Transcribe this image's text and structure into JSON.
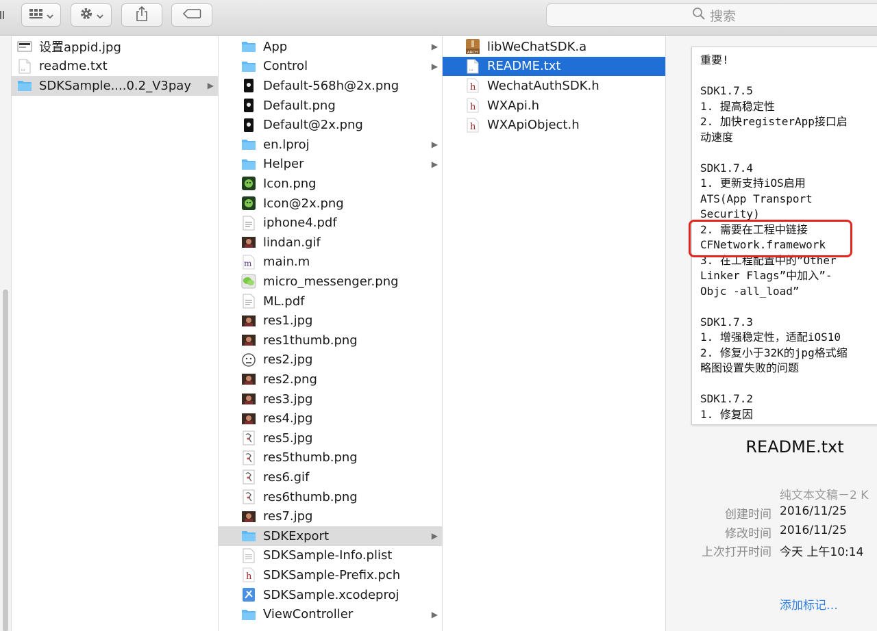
{
  "toolbar": {
    "search_placeholder": "搜索"
  },
  "column1": [
    {
      "name": "设置appid.jpg",
      "icon": "image-icon"
    },
    {
      "name": "readme.txt",
      "icon": "text-file-icon"
    },
    {
      "name": "SDKSample....0.2_V3pay",
      "icon": "folder-icon",
      "folder": true,
      "selected": true
    }
  ],
  "column2": [
    {
      "name": "App",
      "icon": "folder-icon",
      "folder": true
    },
    {
      "name": "Control",
      "icon": "folder-icon",
      "folder": true
    },
    {
      "name": "Default-568h@2x.png",
      "icon": "phone-image-icon"
    },
    {
      "name": "Default.png",
      "icon": "phone-image-icon"
    },
    {
      "name": "Default@2x.png",
      "icon": "phone-image-icon"
    },
    {
      "name": "en.lproj",
      "icon": "folder-icon",
      "folder": true
    },
    {
      "name": "Helper",
      "icon": "folder-icon",
      "folder": true
    },
    {
      "name": "Icon.png",
      "icon": "app-image-icon"
    },
    {
      "name": "Icon@2x.png",
      "icon": "app-image-icon"
    },
    {
      "name": "iphone4.pdf",
      "icon": "pdf-icon"
    },
    {
      "name": "lindan.gif",
      "icon": "photo-icon"
    },
    {
      "name": "main.m",
      "icon": "m-source-icon"
    },
    {
      "name": "micro_messenger.png",
      "icon": "wechat-image-icon"
    },
    {
      "name": "ML.pdf",
      "icon": "pdf-icon"
    },
    {
      "name": "res1.jpg",
      "icon": "photo-icon"
    },
    {
      "name": "res1thumb.png",
      "icon": "photo-icon"
    },
    {
      "name": "res2.jpg",
      "icon": "emoji-image-icon"
    },
    {
      "name": "res2.png",
      "icon": "photo-icon"
    },
    {
      "name": "res3.jpg",
      "icon": "photo-icon"
    },
    {
      "name": "res4.jpg",
      "icon": "photo-icon"
    },
    {
      "name": "res5.jpg",
      "icon": "sketch-image-icon"
    },
    {
      "name": "res5thumb.png",
      "icon": "sketch-image-icon"
    },
    {
      "name": "res6.gif",
      "icon": "sketch-image-icon"
    },
    {
      "name": "res6thumb.png",
      "icon": "sketch-image-icon"
    },
    {
      "name": "res7.jpg",
      "icon": "photo-icon"
    },
    {
      "name": "SDKExport",
      "icon": "folder-icon",
      "folder": true,
      "selected": true
    },
    {
      "name": "SDKSample-Info.plist",
      "icon": "plist-icon"
    },
    {
      "name": "SDKSample-Prefix.pch",
      "icon": "h-source-icon"
    },
    {
      "name": "SDKSample.xcodeproj",
      "icon": "xcodeproj-icon"
    },
    {
      "name": "ViewController",
      "icon": "folder-icon",
      "folder": true
    }
  ],
  "column3": [
    {
      "name": "libWeChatSDK.a",
      "icon": "archive-icon"
    },
    {
      "name": "README.txt",
      "icon": "text-file-icon",
      "selected": true
    },
    {
      "name": "WechatAuthSDK.h",
      "icon": "h-source-icon"
    },
    {
      "name": "WXApi.h",
      "icon": "h-source-icon"
    },
    {
      "name": "WXApiObject.h",
      "icon": "h-source-icon"
    }
  ],
  "preview": {
    "lines": [
      "重要!",
      "",
      "SDK1.7.5",
      "1. 提高稳定性",
      "2. 加快registerApp接口启",
      "动速度",
      "",
      "SDK1.7.4",
      "1. 更新支持iOS启用",
      "ATS(App Transport",
      "Security)",
      "2. 需要在工程中链接",
      "CFNetwork.framework",
      "3. 在工程配置中的”Other",
      "Linker Flags”中加入”-",
      "Objc -all_load”",
      "",
      "SDK1.7.3",
      "1. 增强稳定性，适配iOS10",
      "2. 修复小于32K的jpg格式缩",
      "略图设置失败的问题",
      "",
      "SDK1.7.2",
      "1. 修复因"
    ],
    "file_name": "README.txt",
    "kind": "纯文本文稿－2 K",
    "meta": [
      {
        "key": "创建时间",
        "value": "2016/11/25"
      },
      {
        "key": "修改时间",
        "value": "2016/11/25"
      },
      {
        "key": "上次打开时间",
        "value": "今天 上午10:14"
      }
    ],
    "add_tags": "添加标记…"
  },
  "colors": {
    "selection_blue": "#1f6fd6",
    "selection_gray": "#dcdcdc",
    "highlight_red": "#e2251f",
    "folder_blue": "#5fb7f4",
    "link_blue": "#2e7fe0"
  }
}
